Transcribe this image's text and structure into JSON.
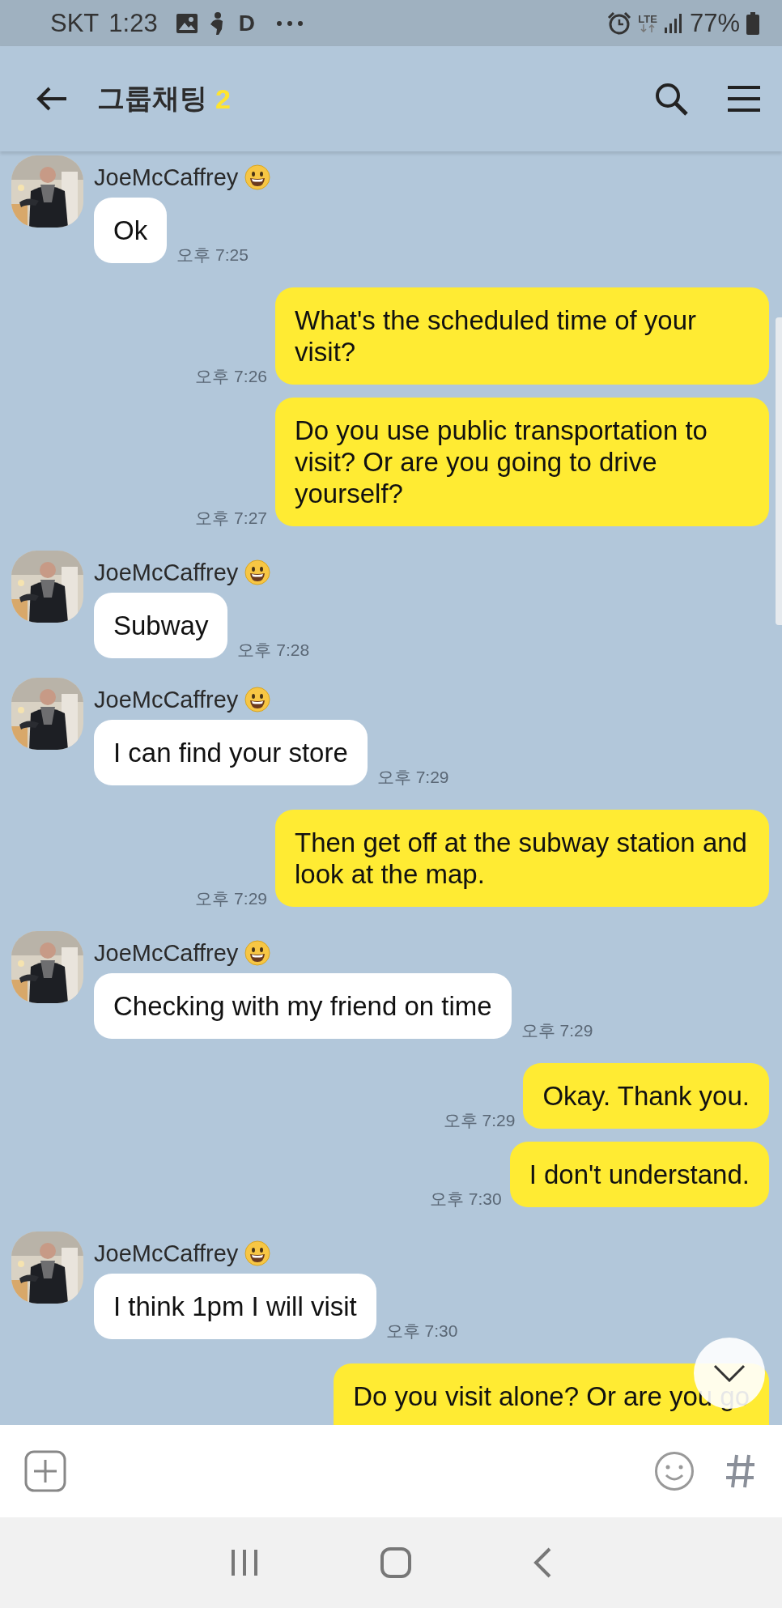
{
  "status_bar": {
    "carrier": "SKT",
    "time": "1:23",
    "app_letter": "D",
    "network": "LTE",
    "battery": "77%"
  },
  "header": {
    "title": "그룹채팅",
    "member_count": "2"
  },
  "messages": [
    {
      "kind": "received",
      "sender": "JoeMcCaffrey",
      "text": "Ok",
      "time": "오후 7:25"
    },
    {
      "kind": "sent",
      "text": "What's the scheduled time of your visit?",
      "time": "오후 7:26"
    },
    {
      "kind": "sent",
      "text": "Do you use public transportation to visit? Or are you going to drive yourself?",
      "time": "오후 7:27"
    },
    {
      "kind": "received",
      "sender": "JoeMcCaffrey",
      "text": "Subway",
      "time": "오후 7:28"
    },
    {
      "kind": "received",
      "sender": "JoeMcCaffrey",
      "text": "I can find your store",
      "time": "오후 7:29"
    },
    {
      "kind": "sent",
      "text": "Then get off at the subway station and look at the map.",
      "time": "오후 7:29"
    },
    {
      "kind": "received",
      "sender": "JoeMcCaffrey",
      "text": "Checking with my friend on time",
      "time": "오후 7:29"
    },
    {
      "kind": "sent",
      "text": "Okay. Thank you.",
      "time": "오후 7:29"
    },
    {
      "kind": "sent",
      "text": "I don't understand.",
      "time": "오후 7:30"
    },
    {
      "kind": "received",
      "sender": "JoeMcCaffrey",
      "text": "I think 1pm I will visit",
      "time": "오후 7:30"
    },
    {
      "kind": "sent",
      "text": "Do you visit alone? Or are you go"
    }
  ]
}
